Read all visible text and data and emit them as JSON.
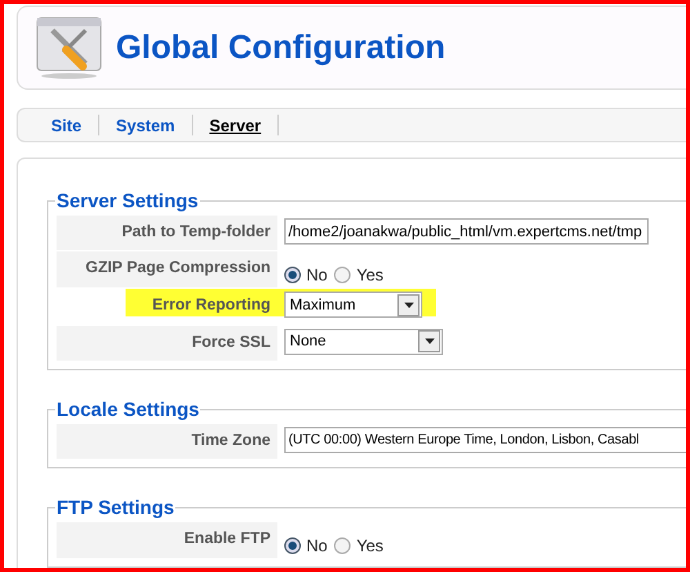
{
  "header": {
    "title": "Global Configuration"
  },
  "tabs": [
    {
      "label": "Site",
      "selected": false
    },
    {
      "label": "System",
      "selected": false
    },
    {
      "label": "Server",
      "selected": true
    }
  ],
  "sections": [
    {
      "title": "Server Settings",
      "rows": [
        {
          "label": "Path to Temp-folder",
          "kind": "text",
          "value": "/home2/joanakwa/public_html/vm.expertcms.net/tmp",
          "highlighted": false
        },
        {
          "label": "GZIP Page Compression",
          "kind": "radio",
          "options": [
            {
              "label": "No",
              "selected": true
            },
            {
              "label": "Yes",
              "selected": false
            }
          ],
          "highlighted": false
        },
        {
          "label": "Error Reporting",
          "kind": "select",
          "value": "Maximum",
          "highlighted": true
        },
        {
          "label": "Force SSL",
          "kind": "select",
          "value": "None",
          "highlighted": false
        }
      ]
    },
    {
      "title": "Locale Settings",
      "rows": [
        {
          "label": "Time Zone",
          "kind": "wide",
          "value": "(UTC 00:00) Western Europe Time, London, Lisbon, Casabl",
          "highlighted": false
        }
      ]
    },
    {
      "title": "FTP Settings",
      "rows": [
        {
          "label": "Enable FTP",
          "kind": "radio",
          "options": [
            {
              "label": "No",
              "selected": true
            },
            {
              "label": "Yes",
              "selected": false
            }
          ],
          "highlighted": false
        }
      ]
    }
  ]
}
